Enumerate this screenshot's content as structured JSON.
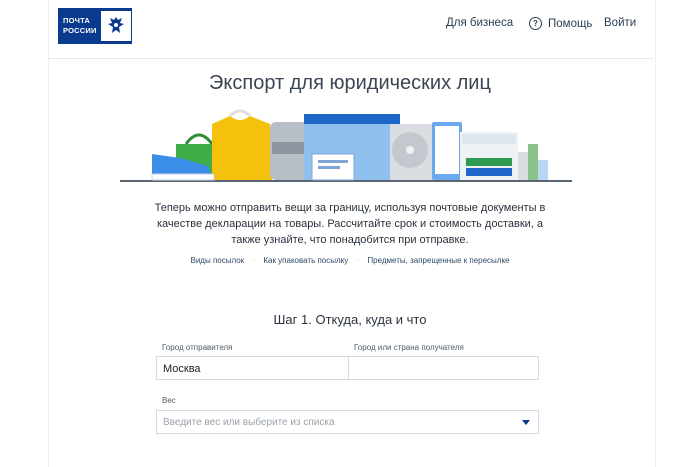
{
  "header": {
    "logo_line1": "ПОЧТА",
    "logo_line2": "РОССИИ",
    "logo_icon": "eagle-emblem-icon",
    "nav_business": "Для бизнеса",
    "nav_help": "Помощь",
    "nav_help_icon": "?",
    "nav_login": "Войти",
    "brand_color": "#0a3a8d"
  },
  "main": {
    "title": "Экспорт для юридических лиц",
    "lead_line1": "Теперь можно отправить вещи за границу, используя почтовые документы в",
    "lead_line2": "качестве декларации на товары. Рассчитайте срок и стоимость доставки, а",
    "lead_line3": "также узнайте, что понадобится при отправке.",
    "links": [
      "Виды посылок",
      "Как упаковать посылку",
      "Предметы, запрещенные к пересылке"
    ],
    "link_separator": "·"
  },
  "form": {
    "step_title": "Шаг 1. Откуда, куда и что",
    "sender_label": "Город отправителя",
    "sender_value": "Москва",
    "recipient_label": "Город или страна получателя",
    "recipient_value": "",
    "weight_label": "Вес",
    "weight_placeholder": "Введите вес или выберите из списка"
  }
}
